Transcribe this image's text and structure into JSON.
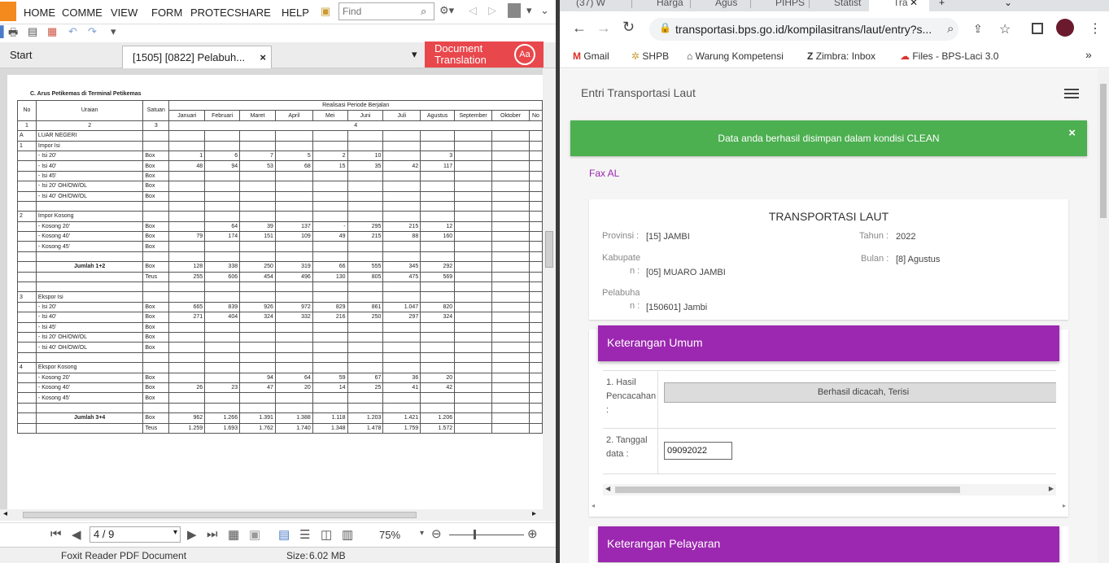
{
  "pdf": {
    "menu": [
      "HOME",
      "COMME",
      "VIEW",
      "FORM",
      "PROTEC",
      "SHARE",
      "HELP"
    ],
    "find_placeholder": "Find",
    "tabs": {
      "start": "Start",
      "active": "[1505] [0822] Pelabuh...",
      "close": "×"
    },
    "doc_translation": "Document Translation",
    "doc_translation_icon": "Aa",
    "page_indicator": "4 / 9",
    "zoom": "75%",
    "status_app": "Foxit Reader PDF Document",
    "status_size_label": "Size:",
    "status_size": "6.02 MB",
    "caption": "C. Arus Petikemas di Terminal Petikemas",
    "table": {
      "header_cols": [
        "No",
        "Uraian",
        "Satuan",
        "Realisasi Periode Berjalan"
      ],
      "months": [
        "Januari",
        "Februari",
        "Maret",
        "April",
        "Mei",
        "Juni",
        "Juli",
        "Agustus",
        "September",
        "Oktober",
        "No"
      ],
      "index_row": [
        "1",
        "2",
        "3",
        "4"
      ],
      "rows": [
        [
          "A",
          "LUAR NEGERI",
          "",
          "",
          "",
          "",
          "",
          "",
          "",
          "",
          "",
          "",
          "",
          ""
        ],
        [
          "1",
          "Impor Isi",
          "",
          "",
          "",
          "",
          "",
          "",
          "",
          "",
          "",
          "",
          "",
          ""
        ],
        [
          "",
          "-    Isi 20'",
          "Box",
          "1",
          "6",
          "7",
          "5",
          "2",
          "10",
          "",
          "3",
          "",
          "",
          ""
        ],
        [
          "",
          "-    Isi 40'",
          "Box",
          "48",
          "94",
          "53",
          "68",
          "15",
          "35",
          "42",
          "117",
          "",
          "",
          ""
        ],
        [
          "",
          "-    Isi 45'",
          "Box",
          "",
          "",
          "",
          "",
          "",
          "",
          "",
          "",
          "",
          "",
          ""
        ],
        [
          "",
          "-    Isi 20' OH/OW/OL",
          "Box",
          "",
          "",
          "",
          "",
          "",
          "",
          "",
          "",
          "",
          "",
          ""
        ],
        [
          "",
          "-    Isi 40' OH/OW/OL",
          "Box",
          "",
          "",
          "",
          "",
          "",
          "",
          "",
          "",
          "",
          "",
          ""
        ],
        [
          "",
          "",
          "",
          "",
          "",
          "",
          "",
          "",
          "",
          "",
          "",
          "",
          "",
          ""
        ],
        [
          "2",
          "Impor Kosong",
          "",
          "",
          "",
          "",
          "",
          "",
          "",
          "",
          "",
          "",
          "",
          ""
        ],
        [
          "",
          "-    Kosong 20'",
          "Box",
          "",
          "64",
          "39",
          "137",
          "-",
          "295",
          "215",
          "12",
          "",
          "",
          ""
        ],
        [
          "",
          "-    Kosong 40'",
          "Box",
          "79",
          "174",
          "151",
          "109",
          "49",
          "215",
          "88",
          "160",
          "",
          "",
          ""
        ],
        [
          "",
          "-    Kosong 45'",
          "Box",
          "",
          "",
          "",
          "",
          "",
          "",
          "",
          "",
          "",
          "",
          ""
        ],
        [
          "",
          "",
          "",
          "",
          "",
          "",
          "",
          "",
          "",
          "",
          "",
          "",
          "",
          ""
        ],
        [
          "",
          "Jumlah 1+2",
          "Box",
          "128",
          "338",
          "250",
          "319",
          "66",
          "555",
          "345",
          "292",
          "",
          "",
          ""
        ],
        [
          "",
          "",
          "Teus",
          "255",
          "606",
          "454",
          "496",
          "130",
          "805",
          "475",
          "569",
          "",
          "",
          ""
        ],
        [
          "",
          "",
          "",
          "",
          "",
          "",
          "",
          "",
          "",
          "",
          "",
          "",
          "",
          ""
        ],
        [
          "3",
          "Ekspor Isi",
          "",
          "",
          "",
          "",
          "",
          "",
          "",
          "",
          "",
          "",
          "",
          ""
        ],
        [
          "",
          "-    Isi 20'",
          "Box",
          "665",
          "839",
          "926",
          "972",
          "829",
          "861",
          "1.047",
          "820",
          "",
          "",
          ""
        ],
        [
          "",
          "-    Isi 40'",
          "Box",
          "271",
          "404",
          "324",
          "332",
          "216",
          "250",
          "297",
          "324",
          "",
          "",
          ""
        ],
        [
          "",
          "-    Isi 45'",
          "Box",
          "",
          "",
          "",
          "",
          "",
          "",
          "",
          "",
          "",
          "",
          ""
        ],
        [
          "",
          "-    Isi 20' OH/OW/OL",
          "Box",
          "",
          "",
          "",
          "",
          "",
          "",
          "",
          "",
          "",
          "",
          ""
        ],
        [
          "",
          "-    Isi 40' OH/OW/OL",
          "Box",
          "",
          "",
          "",
          "",
          "",
          "",
          "",
          "",
          "",
          "",
          ""
        ],
        [
          "",
          "",
          "",
          "",
          "",
          "",
          "",
          "",
          "",
          "",
          "",
          "",
          "",
          ""
        ],
        [
          "4",
          "Ekspor Kosong",
          "",
          "",
          "",
          "",
          "",
          "",
          "",
          "",
          "",
          "",
          "",
          ""
        ],
        [
          "",
          "-    Kosong 20'",
          "Box",
          "",
          "",
          "94",
          "64",
          "59",
          "67",
          "36",
          "20",
          "",
          "",
          ""
        ],
        [
          "",
          "-    Kosong 40'",
          "Box",
          "26",
          "23",
          "47",
          "20",
          "14",
          "25",
          "41",
          "42",
          "",
          "",
          ""
        ],
        [
          "",
          "-    Kosong 45'",
          "Box",
          "",
          "",
          "",
          "",
          "",
          "",
          "",
          "",
          "",
          "",
          ""
        ],
        [
          "",
          "",
          "",
          "",
          "",
          "",
          "",
          "",
          "",
          "",
          "",
          "",
          "",
          ""
        ],
        [
          "",
          "Jumlah 3+4",
          "Box",
          "962",
          "1.266",
          "1.391",
          "1.388",
          "1.118",
          "1.203",
          "1.421",
          "1.206",
          "",
          "",
          ""
        ],
        [
          "",
          "",
          "Teus",
          "1.259",
          "1.693",
          "1.762",
          "1.740",
          "1.348",
          "1.478",
          "1.759",
          "1.572",
          "",
          "",
          ""
        ]
      ]
    }
  },
  "chrome": {
    "tabs": [
      "(37) W",
      "Harga",
      "Agus",
      "PIHPS",
      "Statist",
      "Tra"
    ],
    "url": "transportasi.bps.go.id/kompilasitrans/laut/entry?s...",
    "bookmarks": [
      "Gmail",
      "SHPB",
      "Warung Kompetensi",
      "Zimbra: Inbox",
      "Files - BPS-Laci 3.0"
    ],
    "bookmarks_more": "»"
  },
  "app": {
    "title": "Entri Transportasi Laut",
    "alert": "Data anda berhasil disimpan dalam kondisi CLEAN",
    "alert_close": "×",
    "fax_link": "Fax AL",
    "card_title": "TRANSPORTASI LAUT",
    "fields": {
      "provinsi_label": "Provinsi :",
      "provinsi": "[15] JAMBI",
      "tahun_label": "Tahun :",
      "tahun": "2022",
      "kabupaten_label_1": "Kabupate",
      "kabupaten_label_2": "n :",
      "kabupaten": "[05] MUARO JAMBI",
      "bulan_label": "Bulan :",
      "bulan": "[8] Agustus",
      "pelabuhan_label_1": "Pelabuha",
      "pelabuhan_label_2": "n :",
      "pelabuhan": "[150601] Jambi"
    },
    "section1": "Keterangan Umum",
    "q1_label": "1. Hasil Pencacahan :",
    "q1_value": "Berhasil dicacah, Terisi",
    "q2_label": "2. Tanggal data :",
    "q2_value": "09092022",
    "section2": "Keterangan Pelayaran"
  },
  "colors": {
    "accent": "#9c27b0",
    "success": "#4caf50",
    "foxit": "#f38a1d",
    "translate": "#e8474c"
  }
}
